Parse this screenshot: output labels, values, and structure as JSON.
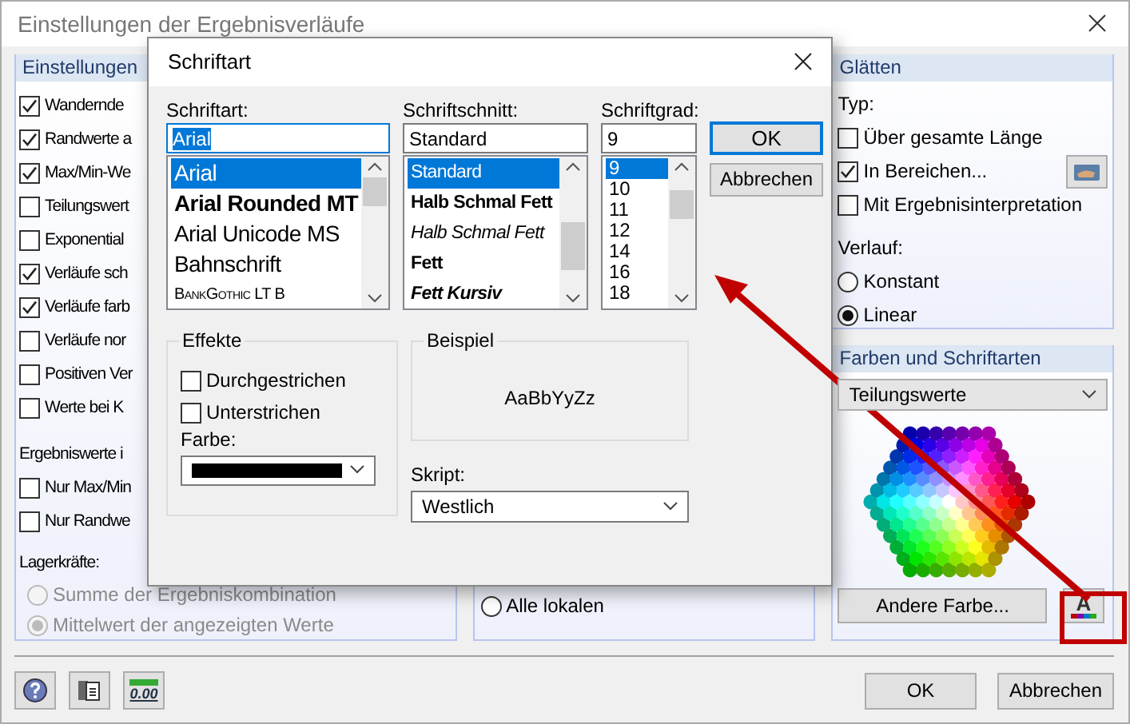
{
  "window": {
    "title": "Einstellungen der Ergebnisverläufe"
  },
  "settings_panel": {
    "title": "Einstellungen",
    "options": [
      {
        "label": "Wandernde",
        "checked": true
      },
      {
        "label": "Randwerte a",
        "checked": true
      },
      {
        "label": "Max/Min-We",
        "checked": true
      },
      {
        "label": "Teilungswert",
        "checked": false
      },
      {
        "label": "Exponential",
        "checked": false
      },
      {
        "label": "Verläufe sch",
        "checked": true
      },
      {
        "label": "Verläufe farb",
        "checked": true
      },
      {
        "label": "Verläufe nor",
        "checked": false
      },
      {
        "label": "Positiven Ver",
        "checked": false
      },
      {
        "label": "Werte bei  K",
        "checked": false
      }
    ],
    "result_values_label": "Ergebniswerte i",
    "result_options": [
      {
        "label": "Nur Max/Min",
        "checked": false
      },
      {
        "label": "Nur Randwe",
        "checked": false
      }
    ],
    "support_forces_label": "Lagerkräfte:",
    "support_options": [
      {
        "label": "Summe der Ergebniskombination",
        "selected": false,
        "disabled": true
      },
      {
        "label": "Mittelwert der angezeigten Werte",
        "selected": true,
        "disabled": true
      }
    ]
  },
  "middle_panel": {
    "options": [
      {
        "label": "Alle lokalen",
        "selected": false
      }
    ]
  },
  "smoothing_panel": {
    "title": "Glätten",
    "type_label": "Typ:",
    "type_options": [
      {
        "label": "Über gesamte Länge",
        "checked": false
      },
      {
        "label": "In Bereichen...",
        "checked": true
      },
      {
        "label": "Mit Ergebnisinterpretation",
        "checked": false
      }
    ],
    "course_label": "Verlauf:",
    "course_options": [
      {
        "label": "Konstant",
        "selected": false
      },
      {
        "label": "Linear",
        "selected": true
      }
    ]
  },
  "colors_panel": {
    "title": "Farben und Schriftarten",
    "select_value": "Teilungswerte",
    "other_color_button": "Andere Farbe...",
    "font_color_button": "A"
  },
  "toolbar": {
    "decimal_button": "0.00"
  },
  "footer_buttons": [
    "OK",
    "Abbrechen"
  ],
  "font_dialog": {
    "title": "Schriftart",
    "font": {
      "label": "Schriftart:",
      "value": "Arial",
      "items": [
        {
          "label": "Arial",
          "kind": "regular",
          "selected": true
        },
        {
          "label": "Arial Rounded MT",
          "kind": "bold",
          "selected": false
        },
        {
          "label": "Arial Unicode MS",
          "kind": "regular",
          "selected": false
        },
        {
          "label": "Bahnschrift",
          "kind": "regular",
          "selected": false
        },
        {
          "label": "BankGothic LT B",
          "kind": "smallcaps",
          "selected": false
        }
      ]
    },
    "style": {
      "label": "Schriftschnitt:",
      "value": "Standard",
      "items": [
        {
          "label": "Standard",
          "kind": "regular",
          "selected": true
        },
        {
          "label": "Halb Schmal Fett",
          "kind": "bold",
          "selected": false
        },
        {
          "label": "Halb Schmal Fett",
          "kind": "italic",
          "selected": false
        },
        {
          "label": "Fett",
          "kind": "bold",
          "selected": false
        },
        {
          "label": "Fett Kursiv",
          "kind": "bolditalic",
          "selected": false
        }
      ]
    },
    "size": {
      "label": "Schriftgrad:",
      "value": "9",
      "items": [
        {
          "label": "9",
          "selected": true
        },
        {
          "label": "10",
          "selected": false
        },
        {
          "label": "11",
          "selected": false
        },
        {
          "label": "12",
          "selected": false
        },
        {
          "label": "14",
          "selected": false
        },
        {
          "label": "16",
          "selected": false
        },
        {
          "label": "18",
          "selected": false
        }
      ]
    },
    "buttons": [
      "OK",
      "Abbrechen"
    ],
    "effects": {
      "title": "Effekte",
      "options": [
        {
          "label": "Durchgestrichen",
          "checked": false
        },
        {
          "label": "Unterstrichen",
          "checked": false
        }
      ],
      "color_label": "Farbe:",
      "color": "#000000"
    },
    "sample": {
      "title": "Beispiel",
      "text": "AaBbYyZz"
    },
    "script": {
      "label": "Skript:",
      "value": "Westlich"
    }
  }
}
